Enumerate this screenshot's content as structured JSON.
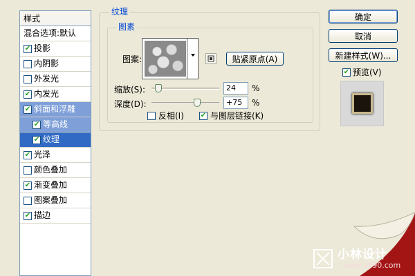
{
  "styles_panel": {
    "header": "样式",
    "items": [
      {
        "label": "混合选项:默认",
        "checkbox": false,
        "checked": false
      },
      {
        "label": "投影",
        "checkbox": true,
        "checked": true
      },
      {
        "label": "内阴影",
        "checkbox": true,
        "checked": false
      },
      {
        "label": "外发光",
        "checkbox": true,
        "checked": false
      },
      {
        "label": "内发光",
        "checkbox": true,
        "checked": true
      },
      {
        "label": "斜面和浮雕",
        "checkbox": true,
        "checked": true
      },
      {
        "label": "等高线",
        "checkbox": true,
        "checked": true
      },
      {
        "label": "纹理",
        "checkbox": true,
        "checked": true
      },
      {
        "label": "光泽",
        "checkbox": true,
        "checked": true
      },
      {
        "label": "颜色叠加",
        "checkbox": true,
        "checked": false
      },
      {
        "label": "渐变叠加",
        "checkbox": true,
        "checked": true
      },
      {
        "label": "图案叠加",
        "checkbox": true,
        "checked": false
      },
      {
        "label": "描边",
        "checkbox": true,
        "checked": true
      }
    ]
  },
  "texture": {
    "group_title": "纹理",
    "subgroup_title": "图素",
    "pattern_label": "图案:",
    "snap_origin_button": "贴紧原点(A)",
    "scale_label": "缩放(S):",
    "scale_value": "24",
    "scale_unit": "%",
    "depth_label": "深度(D):",
    "depth_value": "+75",
    "depth_unit": "%",
    "invert_label": "反相(I)",
    "invert_checked": false,
    "link_label": "与图层链接(K)",
    "link_checked": true
  },
  "actions": {
    "ok": "确定",
    "cancel": "取消",
    "new_style": "新建样式(W)...",
    "preview_label": "预览(V)",
    "preview_checked": true
  },
  "watermark": {
    "brand": "小林设计",
    "url": "www.z990.com"
  },
  "colors": {
    "dialog_bg": "#ece9d8",
    "selection": "#316ac5",
    "group_title": "#0046d5",
    "watermark_red": "#a31515"
  }
}
